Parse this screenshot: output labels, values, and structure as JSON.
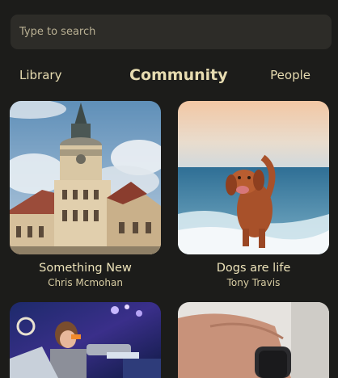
{
  "search": {
    "placeholder": "Type to search"
  },
  "tabs": [
    {
      "label": "Library",
      "active": false
    },
    {
      "label": "Community",
      "active": true
    },
    {
      "label": "People",
      "active": false
    }
  ],
  "cards": [
    {
      "title": "Something New",
      "author": "Chris Mcmohan",
      "image": "ornate building with tower"
    },
    {
      "title": "Dogs are life",
      "author": "Tony Travis",
      "image": "dog running on beach"
    },
    {
      "title": "",
      "author": "",
      "image": "game character artwork"
    },
    {
      "title": "",
      "author": "",
      "image": "hand with smartwatch"
    }
  ]
}
